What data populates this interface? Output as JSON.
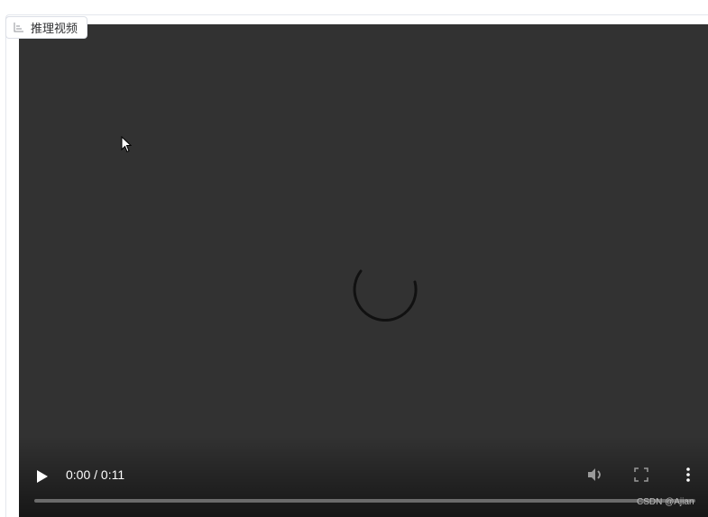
{
  "panel": {
    "tag_label": "推理视频"
  },
  "video": {
    "current_time": "0:00",
    "duration": "0:11",
    "time_separator": "/"
  },
  "watermark": "CSDN @Ajian",
  "icons": {
    "tag_icon": "bar-chart-icon",
    "play": "play-icon",
    "volume": "volume-icon",
    "fullscreen": "fullscreen-icon",
    "more": "more-vertical-icon",
    "spinner": "loading-spinner-icon"
  },
  "colors": {
    "video_bg": "#323232",
    "control_text": "#ffffff",
    "spinner": "#111111"
  }
}
